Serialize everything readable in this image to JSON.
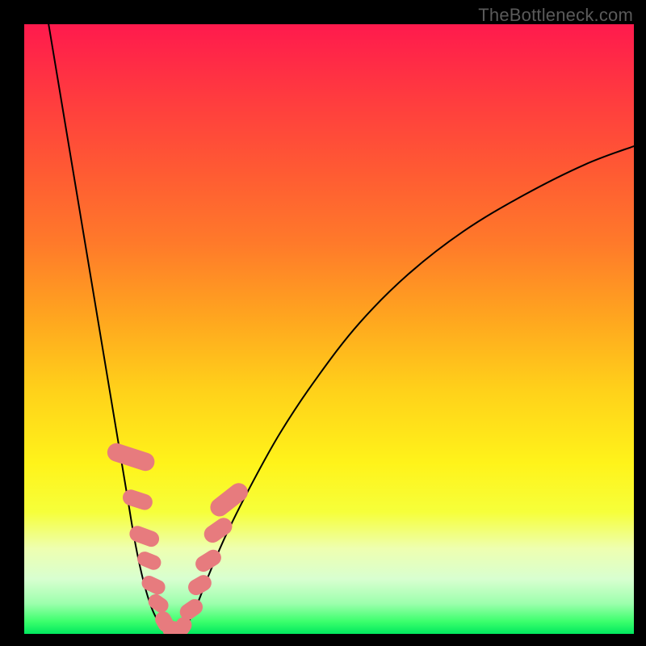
{
  "watermark": "TheBottleneck.com",
  "chart_data": {
    "type": "line",
    "title": "",
    "xlabel": "",
    "ylabel": "",
    "xlim": [
      0,
      100
    ],
    "ylim": [
      0,
      100
    ],
    "grid": false,
    "legend": false,
    "series": [
      {
        "name": "left-curve",
        "color": "#000000",
        "x": [
          4,
          6,
          8,
          10,
          12,
          14,
          16,
          17,
          18,
          19,
          20,
          21,
          22,
          23
        ],
        "y": [
          100,
          88,
          76,
          64,
          52,
          40,
          28,
          22,
          16,
          11,
          7,
          4,
          2,
          0.5
        ]
      },
      {
        "name": "valley-floor",
        "color": "#000000",
        "x": [
          23,
          24,
          25,
          26
        ],
        "y": [
          0.5,
          0.3,
          0.3,
          0.5
        ]
      },
      {
        "name": "right-curve",
        "color": "#000000",
        "x": [
          26,
          28,
          30,
          33,
          37,
          42,
          48,
          55,
          63,
          72,
          82,
          92,
          100
        ],
        "y": [
          0.5,
          4,
          9,
          16,
          24,
          33,
          42,
          51,
          59,
          66,
          72,
          77,
          80
        ]
      }
    ],
    "markers": {
      "name": "sample-points",
      "color": "#e77b7e",
      "shape": "rounded-rect",
      "points": [
        {
          "x": 17.5,
          "y": 29,
          "w": 3.0,
          "h": 8,
          "rot": -72
        },
        {
          "x": 18.6,
          "y": 22,
          "w": 2.6,
          "h": 5,
          "rot": -72
        },
        {
          "x": 19.7,
          "y": 16,
          "w": 2.6,
          "h": 5,
          "rot": -70
        },
        {
          "x": 20.5,
          "y": 12,
          "w": 2.4,
          "h": 4,
          "rot": -68
        },
        {
          "x": 21.2,
          "y": 8,
          "w": 2.4,
          "h": 4,
          "rot": -65
        },
        {
          "x": 22.0,
          "y": 5,
          "w": 2.4,
          "h": 3.5,
          "rot": -55
        },
        {
          "x": 23.0,
          "y": 2,
          "w": 2.6,
          "h": 3.5,
          "rot": -30
        },
        {
          "x": 24.3,
          "y": 0.7,
          "w": 3.2,
          "h": 2.8,
          "rot": 0
        },
        {
          "x": 26.0,
          "y": 1.2,
          "w": 2.6,
          "h": 3.2,
          "rot": 35
        },
        {
          "x": 27.4,
          "y": 4,
          "w": 2.6,
          "h": 4,
          "rot": 55
        },
        {
          "x": 28.8,
          "y": 8,
          "w": 2.6,
          "h": 4,
          "rot": 60
        },
        {
          "x": 30.2,
          "y": 12,
          "w": 2.6,
          "h": 4.5,
          "rot": 58
        },
        {
          "x": 31.8,
          "y": 17,
          "w": 2.8,
          "h": 5,
          "rot": 55
        },
        {
          "x": 33.6,
          "y": 22,
          "w": 3.0,
          "h": 7,
          "rot": 52
        }
      ]
    }
  }
}
